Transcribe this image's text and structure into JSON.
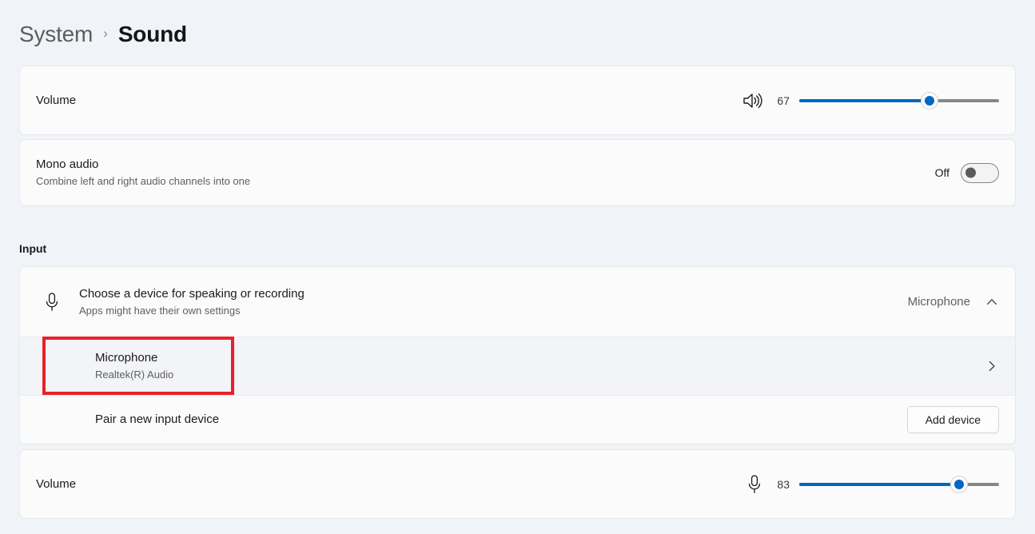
{
  "breadcrumb": {
    "parent": "System",
    "separator": "›",
    "current": "Sound"
  },
  "output": {
    "volume": {
      "label": "Volume",
      "icon": "speaker-volume-high-icon",
      "value": "67",
      "percent": 65
    },
    "mono_audio": {
      "label": "Mono audio",
      "description": "Combine left and right audio channels into one",
      "toggle_state": "Off",
      "toggle_on": false
    }
  },
  "input": {
    "section_title": "Input",
    "choose_device": {
      "icon": "microphone-icon",
      "label": "Choose a device for speaking or recording",
      "description": "Apps might have their own settings",
      "selected_device": "Microphone",
      "expand_icon": "chevron-up-icon",
      "expanded": true
    },
    "device": {
      "name": "Microphone",
      "detail": "Realtek(R) Audio",
      "chevron": "chevron-right-icon",
      "highlighted": true
    },
    "pair": {
      "label": "Pair a new input device",
      "button_label": "Add device"
    },
    "volume": {
      "label": "Volume",
      "icon": "microphone-icon",
      "value": "83",
      "percent": 80
    }
  },
  "colors": {
    "accent": "#0067c0",
    "annotation": "#e8202a",
    "page_background": "#f0f3f8",
    "card_background": "#fbfbfc"
  }
}
